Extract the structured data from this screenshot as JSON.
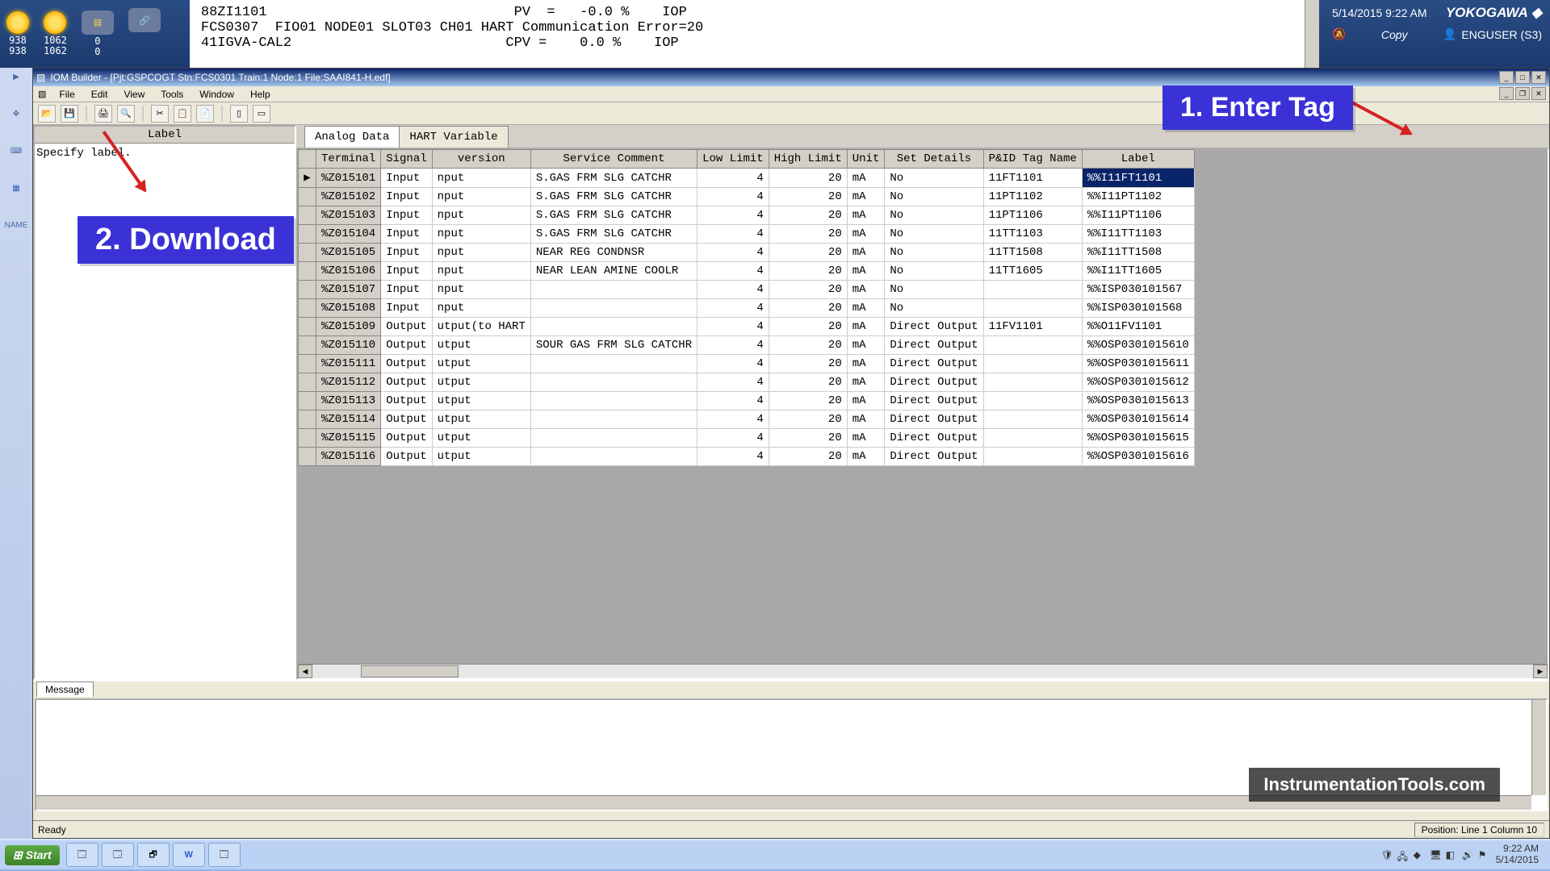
{
  "banner": {
    "icons": [
      {
        "num1": "938",
        "num2": "938"
      },
      {
        "num1": "1062",
        "num2": "1062"
      },
      {
        "num1": "0",
        "num2": "0"
      }
    ],
    "console_lines": [
      "88ZI1101                              PV  =   -0.0 %    IOP",
      "FCS0307  FIO01 NODE01 SLOT03 CH01 HART Communication Error=20",
      "41IGVA-CAL2                          CPV =    0.0 %    IOP"
    ],
    "datetime": "5/14/2015 9:22 AM",
    "brand": "YOKOGAWA ◆",
    "copy": "Copy",
    "user": "ENGUSER (S3)"
  },
  "siderail": {
    "name_label": "NAME"
  },
  "window": {
    "title": "IOM Builder - [Pjt:GSPCOGT Stn:FCS0301 Train:1 Node:1 File:SAAI841-H.edf]",
    "menus": [
      "File",
      "Edit",
      "View",
      "Tools",
      "Window",
      "Help"
    ]
  },
  "left_pane": {
    "header": "Label",
    "body": "Specify label."
  },
  "tabs": {
    "analog": "Analog Data",
    "hart": "HART Variable"
  },
  "columns": [
    "",
    "Terminal",
    "Signal",
    "version",
    "Service Comment",
    "Low Limit",
    "High Limit",
    "Unit",
    "Set Details",
    "P&ID Tag Name",
    "Label"
  ],
  "rows": [
    {
      "mark": "▶",
      "term": "%Z015101",
      "sig": "Input",
      "ver": "nput",
      "svc": "S.GAS FRM   SLG CATCHR",
      "low": "4",
      "high": "20",
      "unit": "mA",
      "det": "No",
      "pid": "11FT1101",
      "label": "%%I11FT1101",
      "sel": true
    },
    {
      "mark": "",
      "term": "%Z015102",
      "sig": "Input",
      "ver": "nput",
      "svc": "S.GAS FRM   SLG CATCHR",
      "low": "4",
      "high": "20",
      "unit": "mA",
      "det": "No",
      "pid": "11PT1102",
      "label": "%%I11PT1102"
    },
    {
      "mark": "",
      "term": "%Z015103",
      "sig": "Input",
      "ver": "nput",
      "svc": "S.GAS FRM   SLG CATCHR",
      "low": "4",
      "high": "20",
      "unit": "mA",
      "det": "No",
      "pid": "11PT1106",
      "label": "%%I11PT1106"
    },
    {
      "mark": "",
      "term": "%Z015104",
      "sig": "Input",
      "ver": "nput",
      "svc": "S.GAS FRM   SLG CATCHR",
      "low": "4",
      "high": "20",
      "unit": "mA",
      "det": "No",
      "pid": "11TT1103",
      "label": "%%I11TT1103"
    },
    {
      "mark": "",
      "term": "%Z015105",
      "sig": "Input",
      "ver": "nput",
      "svc": "NEAR REG    CONDNSR",
      "low": "4",
      "high": "20",
      "unit": "mA",
      "det": "No",
      "pid": "11TT1508",
      "label": "%%I11TT1508"
    },
    {
      "mark": "",
      "term": "%Z015106",
      "sig": "Input",
      "ver": "nput",
      "svc": "NEAR LEAN   AMINE COOLR",
      "low": "4",
      "high": "20",
      "unit": "mA",
      "det": "No",
      "pid": "11TT1605",
      "label": "%%I11TT1605"
    },
    {
      "mark": "",
      "term": "%Z015107",
      "sig": "Input",
      "ver": "nput",
      "svc": "",
      "low": "4",
      "high": "20",
      "unit": "mA",
      "det": "No",
      "pid": "",
      "label": "%%ISP030101567"
    },
    {
      "mark": "",
      "term": "%Z015108",
      "sig": "Input",
      "ver": "nput",
      "svc": "",
      "low": "4",
      "high": "20",
      "unit": "mA",
      "det": "No",
      "pid": "",
      "label": "%%ISP030101568"
    },
    {
      "mark": "",
      "term": "%Z015109",
      "sig": "Output",
      "ver": "utput(to HART",
      "svc": "",
      "low": "4",
      "high": "20",
      "unit": "mA",
      "det": "Direct Output",
      "pid": "11FV1101",
      "label": "%%O11FV1101"
    },
    {
      "mark": "",
      "term": "%Z015110",
      "sig": "Output",
      "ver": "utput",
      "svc": "SOUR GAS FRM SLG CATCHR",
      "low": "4",
      "high": "20",
      "unit": "mA",
      "det": "Direct Output",
      "pid": "",
      "label": "%%OSP0301015610"
    },
    {
      "mark": "",
      "term": "%Z015111",
      "sig": "Output",
      "ver": "utput",
      "svc": "",
      "low": "4",
      "high": "20",
      "unit": "mA",
      "det": "Direct Output",
      "pid": "",
      "label": "%%OSP0301015611"
    },
    {
      "mark": "",
      "term": "%Z015112",
      "sig": "Output",
      "ver": "utput",
      "svc": "",
      "low": "4",
      "high": "20",
      "unit": "mA",
      "det": "Direct Output",
      "pid": "",
      "label": "%%OSP0301015612"
    },
    {
      "mark": "",
      "term": "%Z015113",
      "sig": "Output",
      "ver": "utput",
      "svc": "",
      "low": "4",
      "high": "20",
      "unit": "mA",
      "det": "Direct Output",
      "pid": "",
      "label": "%%OSP0301015613"
    },
    {
      "mark": "",
      "term": "%Z015114",
      "sig": "Output",
      "ver": "utput",
      "svc": "",
      "low": "4",
      "high": "20",
      "unit": "mA",
      "det": "Direct Output",
      "pid": "",
      "label": "%%OSP0301015614"
    },
    {
      "mark": "",
      "term": "%Z015115",
      "sig": "Output",
      "ver": "utput",
      "svc": "",
      "low": "4",
      "high": "20",
      "unit": "mA",
      "det": "Direct Output",
      "pid": "",
      "label": "%%OSP0301015615"
    },
    {
      "mark": "",
      "term": "%Z015116",
      "sig": "Output",
      "ver": "utput",
      "svc": "",
      "low": "4",
      "high": "20",
      "unit": "mA",
      "det": "Direct Output",
      "pid": "",
      "label": "%%OSP0301015616"
    }
  ],
  "message": {
    "tab": "Message"
  },
  "status": {
    "ready": "Ready",
    "pos": "Position: Line    1 Column 10"
  },
  "callouts": {
    "c1": "1. Enter Tag",
    "c2": "2. Download"
  },
  "watermark": "InstrumentationTools.com",
  "taskbar": {
    "start": "Start",
    "time": "9:22 AM",
    "date": "5/14/2015"
  }
}
